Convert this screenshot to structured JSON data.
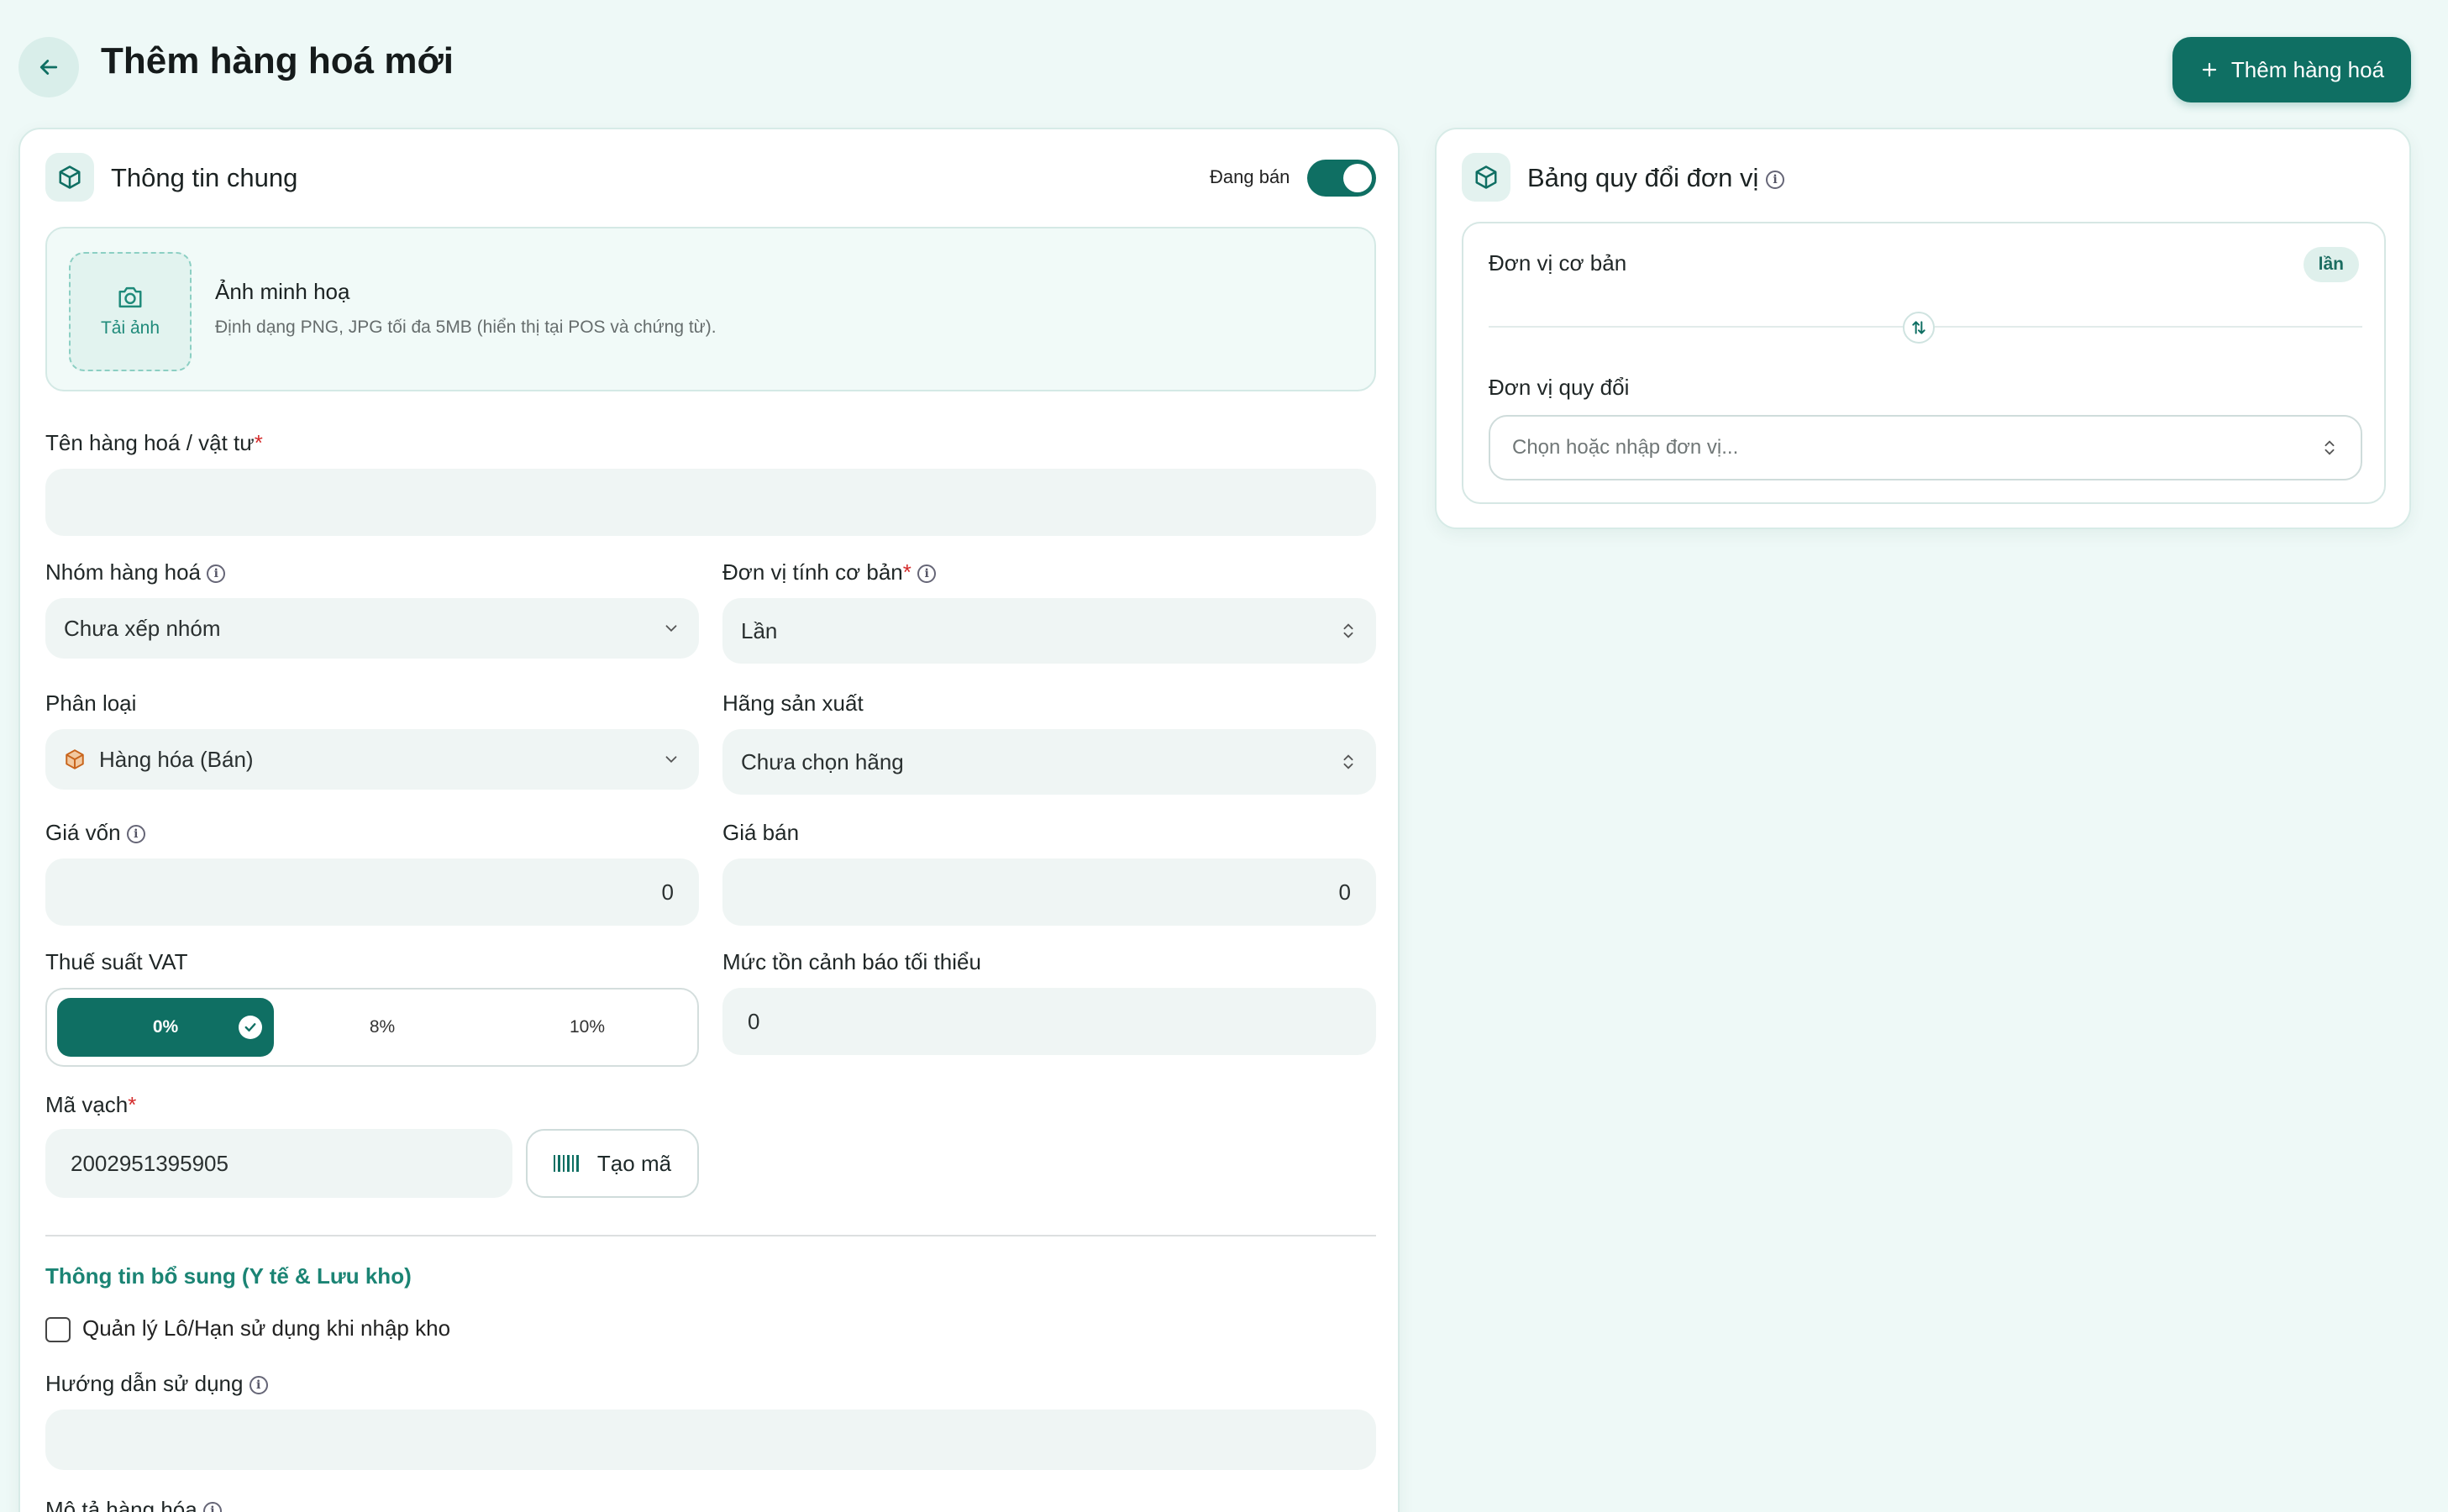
{
  "header": {
    "title": "Thêm hàng hoá mới",
    "add_button_label": "Thêm hàng hoá"
  },
  "general": {
    "title": "Thông tin chung",
    "status_label": "Đang bán",
    "status_on": true,
    "upload": {
      "button_label": "Tải ảnh",
      "title": "Ảnh minh hoạ",
      "hint": "Định dạng PNG, JPG tối đa 5MB (hiển thị tại POS và chứng từ)."
    },
    "name_label": "Tên hàng hoá / vật tư",
    "name_value": "",
    "group_label": "Nhóm hàng hoá",
    "group_value": "Chưa xếp nhóm",
    "base_unit_label": "Đơn vị tính cơ bản",
    "base_unit_value": "Lần",
    "category_label": "Phân loại",
    "category_value": "Hàng hóa (Bán)",
    "manufacturer_label": "Hãng sản xuất",
    "manufacturer_value": "Chưa chọn hãng",
    "cost_label": "Giá vốn",
    "cost_value": "0",
    "price_label": "Giá bán",
    "price_value": "0",
    "vat_label": "Thuế suất VAT",
    "vat_options": [
      "0%",
      "8%",
      "10%"
    ],
    "vat_selected": "0%",
    "min_stock_label": "Mức tồn cảnh báo tối thiểu",
    "min_stock_value": "0",
    "barcode_label": "Mã vạch",
    "barcode_value": "2002951395905",
    "generate_label": "Tạo mã",
    "extra_title": "Thông tin bổ sung (Y tế & Lưu kho)",
    "lot_checkbox_label": "Quản lý Lô/Hạn sử dụng khi nhập kho",
    "lot_checked": false,
    "usage_label": "Hướng dẫn sử dụng",
    "usage_value": "",
    "description_label": "Mô tả hàng hóa"
  },
  "conversion": {
    "title": "Bảng quy đổi đơn vị",
    "base_unit_label": "Đơn vị cơ bản",
    "base_unit_badge": "lần",
    "convert_unit_label": "Đơn vị quy đổi",
    "convert_placeholder": "Chọn hoặc nhập đơn vị..."
  },
  "colors": {
    "primary": "#0f6f63",
    "background": "#eef9f7",
    "accent_text": "#1b8474",
    "required": "#d42b2b"
  },
  "icons": {
    "back": "arrow-left-icon",
    "add": "plus-icon",
    "box": "package-icon",
    "camera": "camera-icon",
    "info": "info-icon",
    "chevron": "chevron-down-icon",
    "updown": "chevrons-up-down-icon",
    "barcode": "barcode-icon",
    "swap": "swap-vertical-icon",
    "check": "check-icon"
  }
}
